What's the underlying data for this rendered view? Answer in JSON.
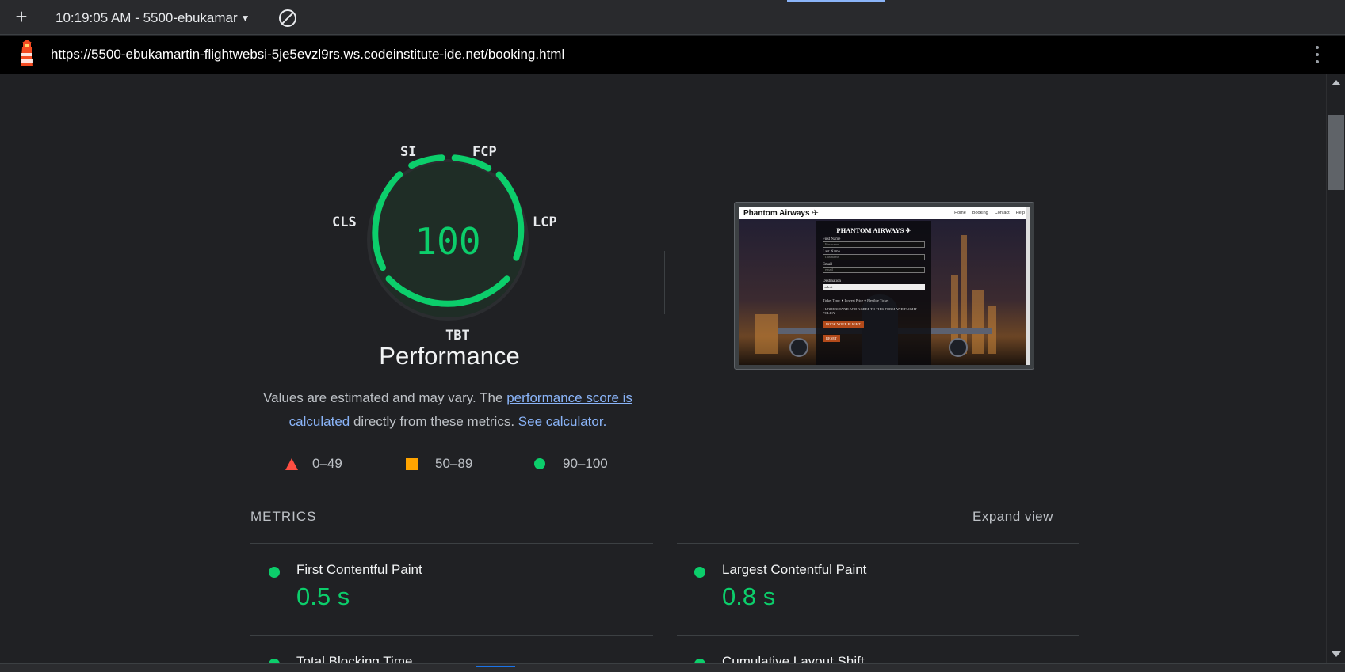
{
  "toolbar": {
    "session_label": "10:19:05 AM - 5500-ebukamar",
    "new_tab_symbol": "+"
  },
  "urlbar": {
    "url": "https://5500-ebukamartin-flightwebsi-5je5evzl9rs.ws.codeinstitute-ide.net/booking.html"
  },
  "gauge": {
    "score": "100",
    "labels": {
      "si": "SI",
      "fcp": "FCP",
      "cls": "CLS",
      "lcp": "LCP",
      "tbt": "TBT"
    },
    "color": "#0cce6b"
  },
  "performance": {
    "title": "Performance",
    "desc_prefix": "Values are estimated and may vary. The ",
    "link1": "performance score is calculated",
    "desc_middle": " directly from these metrics. ",
    "link2": "See calculator."
  },
  "legend": [
    {
      "range": "0–49",
      "shape": "triangle",
      "color": "#ff4e42"
    },
    {
      "range": "50–89",
      "shape": "square",
      "color": "#ffa400"
    },
    {
      "range": "90–100",
      "shape": "circle",
      "color": "#0cce6b"
    }
  ],
  "thumbnail": {
    "brand": "Phantom Airways ✈",
    "nav": [
      "Home",
      "Booking",
      "Contact",
      "Help"
    ],
    "form_title": "PHANTOM AIRWAYS ✈",
    "fields": [
      {
        "label": "First Name",
        "placeholder": "Firstname"
      },
      {
        "label": "Last Name",
        "placeholder": "Lastname"
      },
      {
        "label": "Email",
        "placeholder": "email"
      }
    ],
    "destination_label": "Destination",
    "destination_value": "select",
    "ticket_type": "Ticket Type:   ●  Lowest Price   ●  Flexible Ticket",
    "agree": "I UNDERSTAND AND AGREE TO THIS FORM AND FLIGHT POLICY",
    "book_btn": "BOOK YOUR FLIGHT",
    "reset_btn": "RESET"
  },
  "metrics": {
    "header": "METRICS",
    "expand": "Expand view",
    "items": [
      {
        "title": "First Contentful Paint",
        "value": "0.5 s"
      },
      {
        "title": "Largest Contentful Paint",
        "value": "0.8 s"
      },
      {
        "title": "Total Blocking Time",
        "value": ""
      },
      {
        "title": "Cumulative Layout Shift",
        "value": ""
      }
    ]
  }
}
